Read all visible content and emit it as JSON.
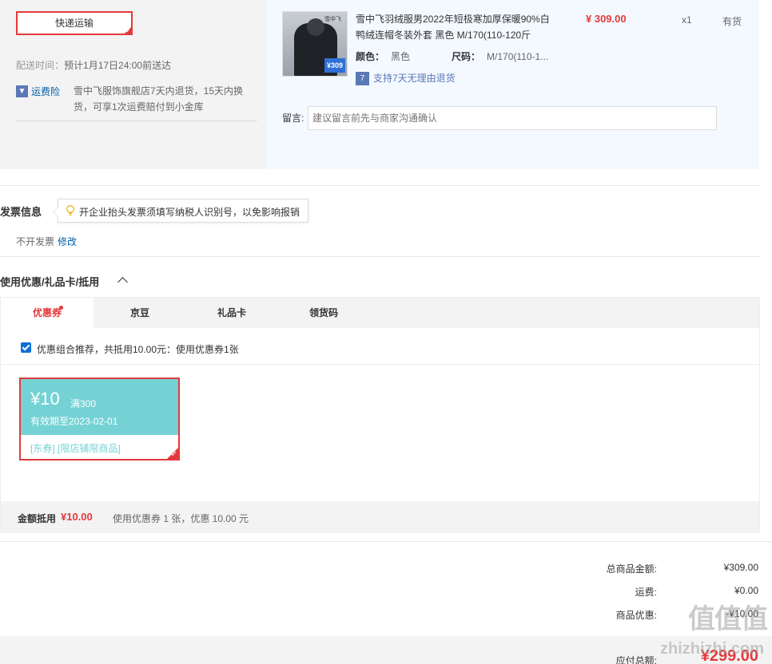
{
  "shipping": {
    "method_label": "快递运输",
    "delivery_key": "配送时间：",
    "delivery_value": "预计1月17日24:00前送达",
    "insurance_icon": "shield-icon",
    "insurance_label": "运费险",
    "insurance_desc": "雪中飞服饰旗舰店7天内退货，15天内换货，可享1次运费赔付到小金库"
  },
  "product": {
    "name": "雪中飞羽绒服男2022年短极寒加厚保暖90%白鸭绒连帽冬装外套 黑色 M/170(110-120斤",
    "price": "¥ 309.00",
    "qty": "x1",
    "stock": "有货",
    "color_key": "颜色：",
    "color_val": "黑色",
    "size_key": "尺码：",
    "size_val": "M/170(110-1...",
    "image_brand": "雪中飞",
    "image_badge": "¥309",
    "return_icon": "7",
    "return_text": "支持7天无理由退货"
  },
  "message": {
    "label": "留言:",
    "placeholder": "建议留言前先与商家沟通确认"
  },
  "invoice": {
    "title": "发票信息",
    "tip": "开企业抬头发票须填写纳税人识别号，以免影响报销",
    "value": "不开发票",
    "edit": "修改"
  },
  "coupons": {
    "title": "使用优惠/礼品卡/抵用",
    "tabs": [
      "优惠券",
      "京豆",
      "礼品卡",
      "领货码"
    ],
    "active_tab": 0,
    "combo_text": "优惠组合推荐，共抵用10.00元：使用优惠券1张",
    "combo_checked": true,
    "card": {
      "amount": "¥10",
      "condition": "满300",
      "expiry": "有效期至2023-02-01",
      "tags": "[东券] [限店铺限商品]"
    },
    "summary_key": "金额抵用",
    "summary_val": "¥10.00",
    "summary_desc": "使用优惠券 1 张，优惠 10.00 元"
  },
  "totals": {
    "goods_label": "总商品金额:",
    "goods_val": "¥309.00",
    "freight_label": "运费:",
    "freight_val": "¥0.00",
    "discount_label": "商品优惠:",
    "discount_val": "-¥10.00",
    "pay_label": "应付总额:",
    "pay_val": "¥299.00"
  },
  "watermark": {
    "glyphs": "值值值",
    "site": "zhizhizhi.com"
  },
  "colors": {
    "accent": "#e4393c",
    "link": "#005ea7",
    "coupon": "#74d2d4",
    "checkbox": "#0b6fd6"
  }
}
